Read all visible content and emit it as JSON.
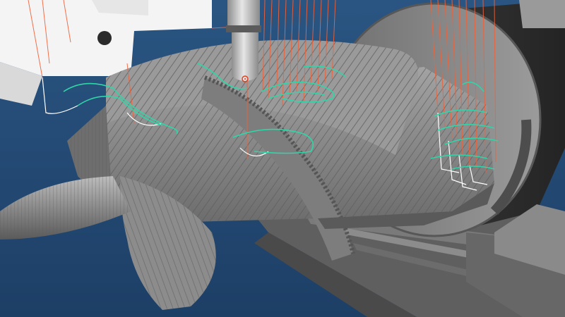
{
  "viewport": {
    "caption": "",
    "background_color": "#22476f",
    "part_color": "#8e8e8e",
    "fixture_color": "#7c7c7c",
    "tool_color": "#c9c9c9",
    "holder_color": "#f2f2f2",
    "rapid_move_color": "#f0623a",
    "cut_move_color": "#2fd6a8",
    "approach_move_color": "#ffffff",
    "icons": [
      "cnc-tool-icon",
      "toolpath-icon"
    ]
  }
}
